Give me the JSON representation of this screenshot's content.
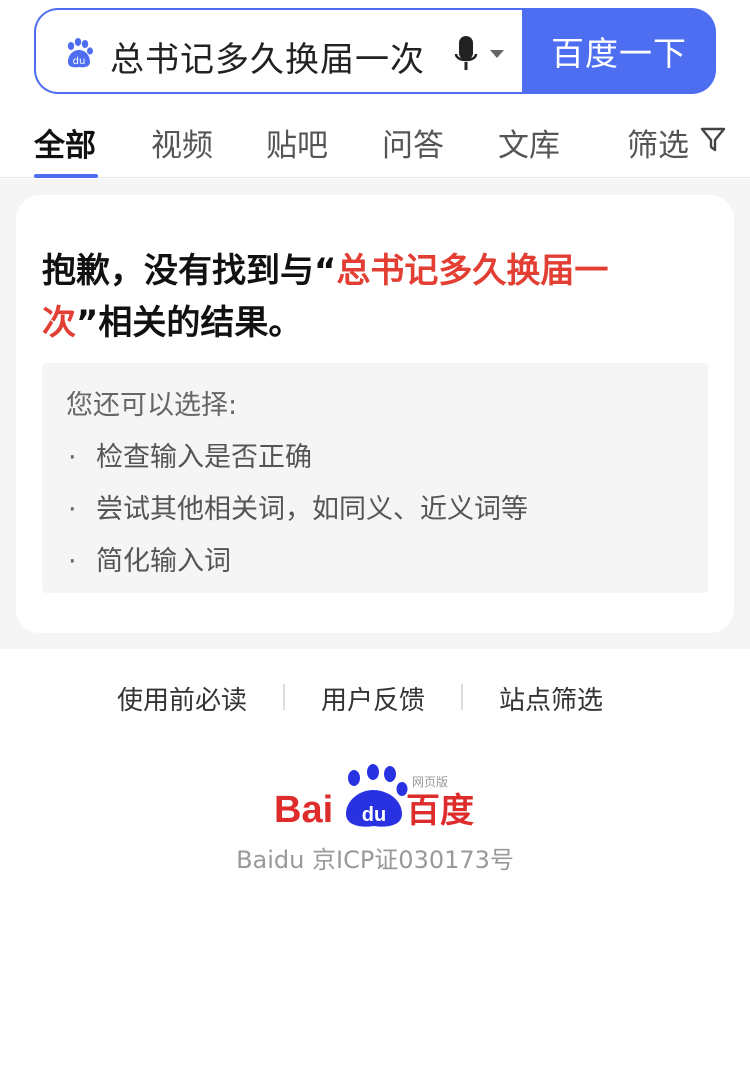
{
  "search": {
    "query": "总书记多久换届一次",
    "button_label": "百度一下"
  },
  "tabs": [
    {
      "label": "全部",
      "active": true
    },
    {
      "label": "视频",
      "active": false
    },
    {
      "label": "贴吧",
      "active": false
    },
    {
      "label": "问答",
      "active": false
    },
    {
      "label": "文库",
      "active": false
    },
    {
      "label": "筛选",
      "active": false
    }
  ],
  "result": {
    "sorry_prefix": "抱歉，没有找到与“",
    "sorry_query": "总书记多久换届一次",
    "sorry_suffix": "”相关的结果。",
    "suggest_title": "您还可以选择:",
    "suggestions": [
      "检查输入是否正确",
      "尝试其他相关词，如同义、近义词等",
      "简化输入词"
    ]
  },
  "footer": {
    "links": [
      "使用前必读",
      "用户反馈",
      "站点筛选"
    ],
    "logo_text_left": "Bai",
    "logo_text_paw": "du",
    "logo_text_cn": "百度",
    "logo_badge": "网页版",
    "icp": "Baidu 京ICP证030173号"
  },
  "colors": {
    "accent": "#4e6ef2",
    "highlight": "#e33e33",
    "logo_red": "#de2c2c",
    "logo_blue": "#2932e1"
  },
  "icons": {
    "search_prefix": "baidu-paw-icon",
    "mic": "microphone-icon",
    "filter": "funnel-icon"
  }
}
